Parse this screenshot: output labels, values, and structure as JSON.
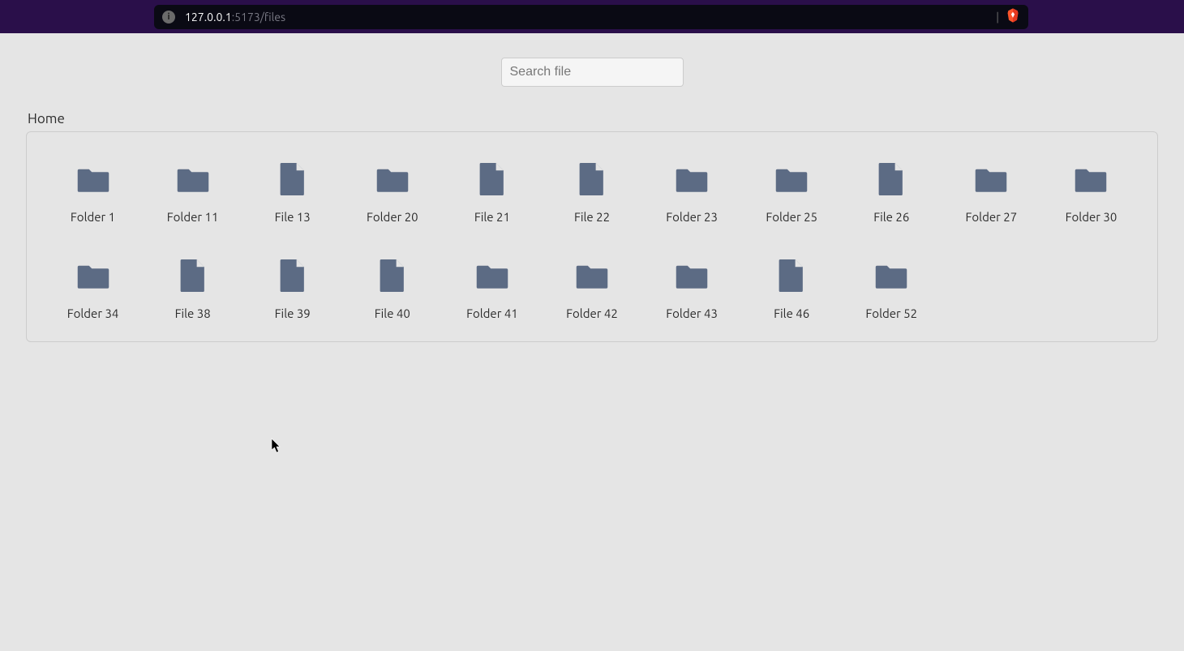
{
  "browser": {
    "url_host": "127.0.0.1",
    "url_rest": ":5173/files"
  },
  "search": {
    "placeholder": "Search file",
    "value": ""
  },
  "breadcrumb": {
    "label": "Home"
  },
  "icon_color": "#5c6b84",
  "items": [
    {
      "type": "folder",
      "label": "Folder 1"
    },
    {
      "type": "folder",
      "label": "Folder 11"
    },
    {
      "type": "file",
      "label": "File 13"
    },
    {
      "type": "folder",
      "label": "Folder 20"
    },
    {
      "type": "file",
      "label": "File 21"
    },
    {
      "type": "file",
      "label": "File 22"
    },
    {
      "type": "folder",
      "label": "Folder 23"
    },
    {
      "type": "folder",
      "label": "Folder 25"
    },
    {
      "type": "file",
      "label": "File 26"
    },
    {
      "type": "folder",
      "label": "Folder 27"
    },
    {
      "type": "folder",
      "label": "Folder 30"
    },
    {
      "type": "folder",
      "label": "Folder 34"
    },
    {
      "type": "file",
      "label": "File 38"
    },
    {
      "type": "file",
      "label": "File 39"
    },
    {
      "type": "file",
      "label": "File 40"
    },
    {
      "type": "folder",
      "label": "Folder 41"
    },
    {
      "type": "folder",
      "label": "Folder 42"
    },
    {
      "type": "folder",
      "label": "Folder 43"
    },
    {
      "type": "file",
      "label": "File 46"
    },
    {
      "type": "folder",
      "label": "Folder 52"
    }
  ]
}
